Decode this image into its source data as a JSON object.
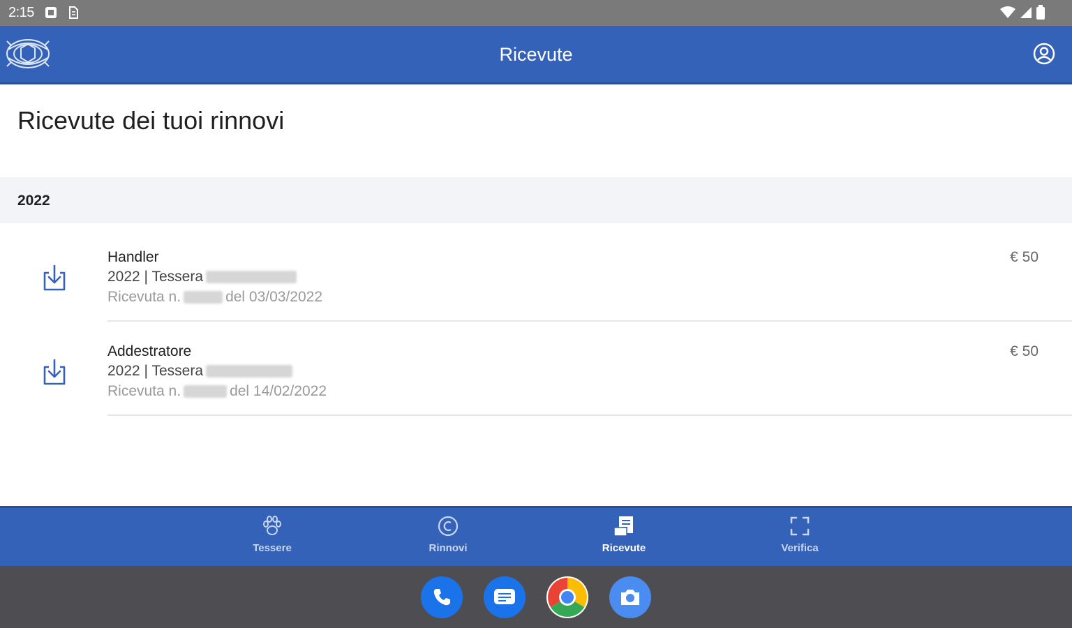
{
  "status_bar": {
    "time": "2:15"
  },
  "app_bar": {
    "title": "Ricevute"
  },
  "page": {
    "title": "Ricevute dei tuoi rinnovi"
  },
  "year_group": {
    "year": "2022",
    "receipts": [
      {
        "role": "Handler",
        "card_prefix": "2022 | Tessera",
        "receipt_prefix": "Ricevuta n.",
        "receipt_date": "del 03/03/2022",
        "amount": "€ 50"
      },
      {
        "role": "Addestratore",
        "card_prefix": "2022 | Tessera",
        "receipt_prefix": "Ricevuta n.",
        "receipt_date": "del 14/02/2022",
        "amount": "€ 50"
      }
    ]
  },
  "bottom_nav": {
    "items": [
      {
        "label": "Tessere",
        "icon": "paw-icon",
        "active": false
      },
      {
        "label": "Rinnovi",
        "icon": "renew-icon",
        "active": false
      },
      {
        "label": "Ricevute",
        "icon": "receipt-icon",
        "active": true
      },
      {
        "label": "Verifica",
        "icon": "scan-icon",
        "active": false
      }
    ]
  },
  "dock": {
    "apps": [
      "phone-icon",
      "messages-icon",
      "chrome-icon",
      "camera-icon"
    ]
  },
  "colors": {
    "primary": "#3462b8",
    "statusbar": "#7a7a7a",
    "dock": "#4e4e52",
    "section_bg": "#f2f4f7"
  }
}
